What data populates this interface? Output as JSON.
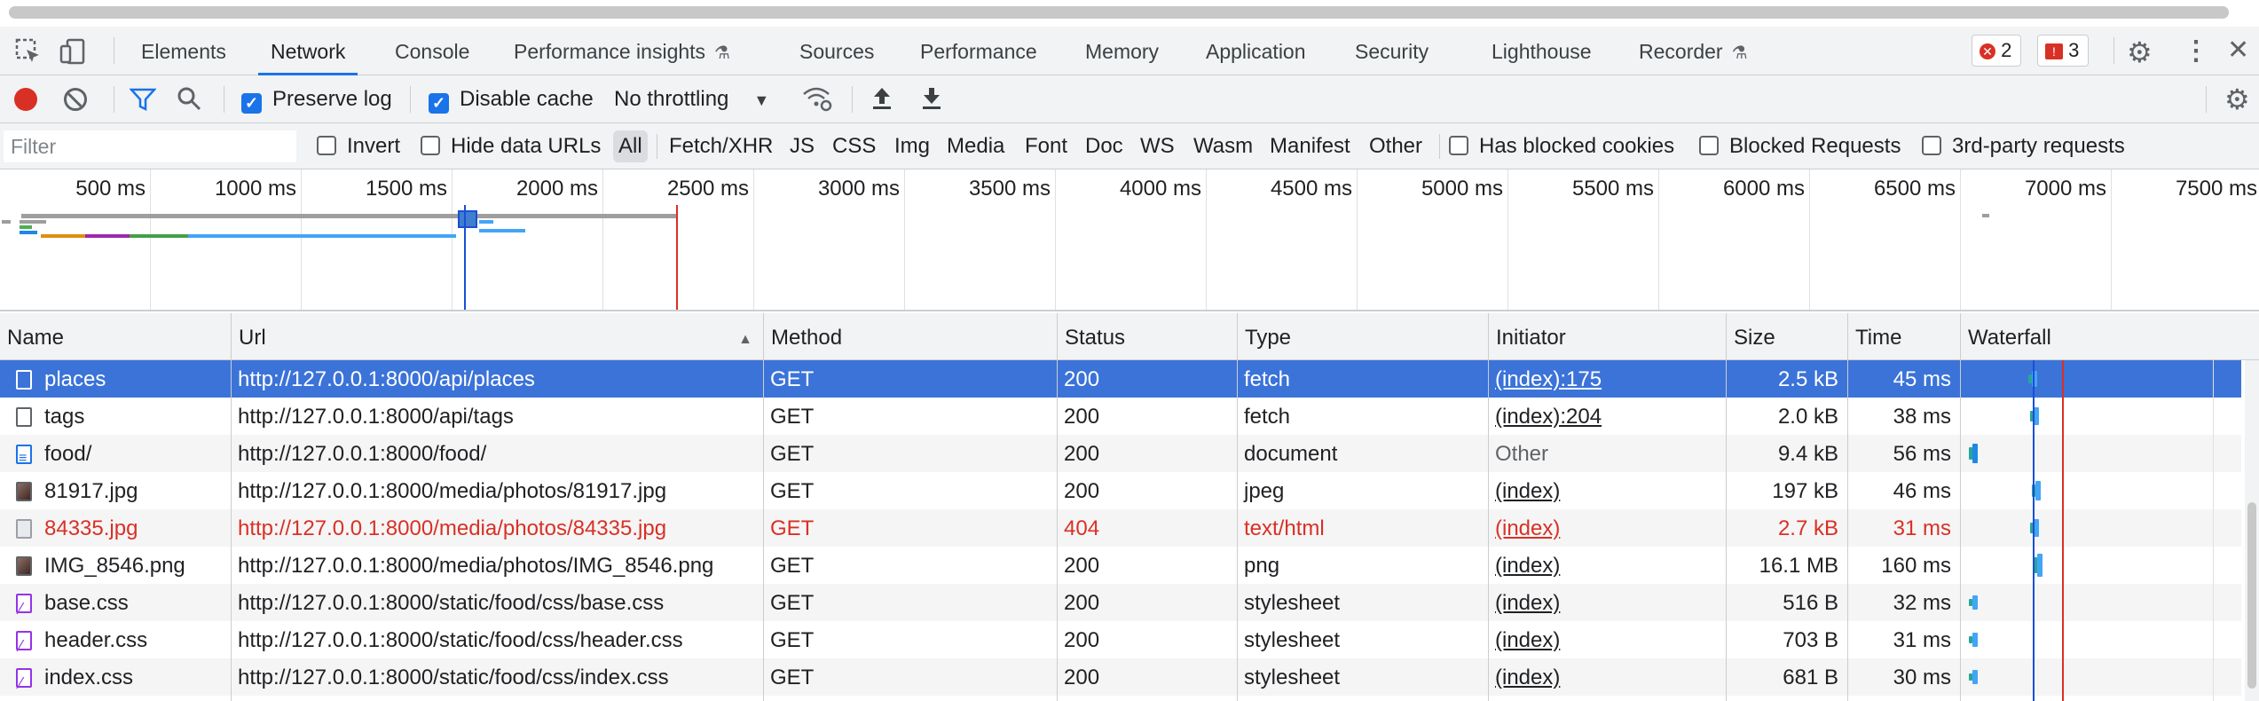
{
  "tabs": [
    "Elements",
    "Network",
    "Console",
    "Performance insights",
    "Sources",
    "Performance",
    "Memory",
    "Application",
    "Security",
    "Lighthouse",
    "Recorder"
  ],
  "active_tab": "Network",
  "error_count": "2",
  "warning_count": "3",
  "toolbar": {
    "preserve_log": "Preserve log",
    "disable_cache": "Disable cache",
    "throttling": "No throttling"
  },
  "filter": {
    "placeholder": "Filter",
    "invert": "Invert",
    "hide_data_urls": "Hide data URLs",
    "types": [
      "All",
      "Fetch/XHR",
      "JS",
      "CSS",
      "Img",
      "Media",
      "Font",
      "Doc",
      "WS",
      "Wasm",
      "Manifest",
      "Other"
    ],
    "blocked_cookies": "Has blocked cookies",
    "blocked_requests": "Blocked Requests",
    "third_party": "3rd-party requests"
  },
  "overview_ticks": [
    "500 ms",
    "1000 ms",
    "1500 ms",
    "2000 ms",
    "2500 ms",
    "3000 ms",
    "3500 ms",
    "4000 ms",
    "4500 ms",
    "5000 ms",
    "5500 ms",
    "6000 ms",
    "6500 ms",
    "7000 ms",
    "7500 ms"
  ],
  "columns": [
    "Name",
    "Url",
    "Method",
    "Status",
    "Type",
    "Initiator",
    "Size",
    "Time",
    "Waterfall"
  ],
  "rows": [
    {
      "name": "places",
      "url": "http://127.0.0.1:8000/api/places",
      "method": "GET",
      "status": "200",
      "type": "fetch",
      "initiator": "(index):175",
      "size": "2.5 kB",
      "time": "45 ms",
      "icon": "blank-file-icon"
    },
    {
      "name": "tags",
      "url": "http://127.0.0.1:8000/api/tags",
      "method": "GET",
      "status": "200",
      "type": "fetch",
      "initiator": "(index):204",
      "size": "2.0 kB",
      "time": "38 ms",
      "icon": "blank-file-icon"
    },
    {
      "name": "food/",
      "url": "http://127.0.0.1:8000/food/",
      "method": "GET",
      "status": "200",
      "type": "document",
      "initiator": "Other",
      "size": "9.4 kB",
      "time": "56 ms",
      "icon": "document-icon"
    },
    {
      "name": "81917.jpg",
      "url": "http://127.0.0.1:8000/media/photos/81917.jpg",
      "method": "GET",
      "status": "200",
      "type": "jpeg",
      "initiator": "(index)",
      "size": "197 kB",
      "time": "46 ms",
      "icon": "image-icon"
    },
    {
      "name": "84335.jpg",
      "url": "http://127.0.0.1:8000/media/photos/84335.jpg",
      "method": "GET",
      "status": "404",
      "type": "text/html",
      "initiator": "(index)",
      "size": "2.7 kB",
      "time": "31 ms",
      "icon": "broken-image-icon"
    },
    {
      "name": "IMG_8546.png",
      "url": "http://127.0.0.1:8000/media/photos/IMG_8546.png",
      "method": "GET",
      "status": "200",
      "type": "png",
      "initiator": "(index)",
      "size": "16.1 MB",
      "time": "160 ms",
      "icon": "image-icon"
    },
    {
      "name": "base.css",
      "url": "http://127.0.0.1:8000/static/food/css/base.css",
      "method": "GET",
      "status": "200",
      "type": "stylesheet",
      "initiator": "(index)",
      "size": "516 B",
      "time": "32 ms",
      "icon": "stylesheet-icon"
    },
    {
      "name": "header.css",
      "url": "http://127.0.0.1:8000/static/food/css/header.css",
      "method": "GET",
      "status": "200",
      "type": "stylesheet",
      "initiator": "(index)",
      "size": "703 B",
      "time": "31 ms",
      "icon": "stylesheet-icon"
    },
    {
      "name": "index.css",
      "url": "http://127.0.0.1:8000/static/food/css/index.css",
      "method": "GET",
      "status": "200",
      "type": "stylesheet",
      "initiator": "(index)",
      "size": "681 B",
      "time": "30 ms",
      "icon": "stylesheet-icon"
    }
  ],
  "colors": {
    "accent": "#1a73e8",
    "selected_row": "#3b73d8",
    "error": "#d93025",
    "record": "#d93025"
  }
}
